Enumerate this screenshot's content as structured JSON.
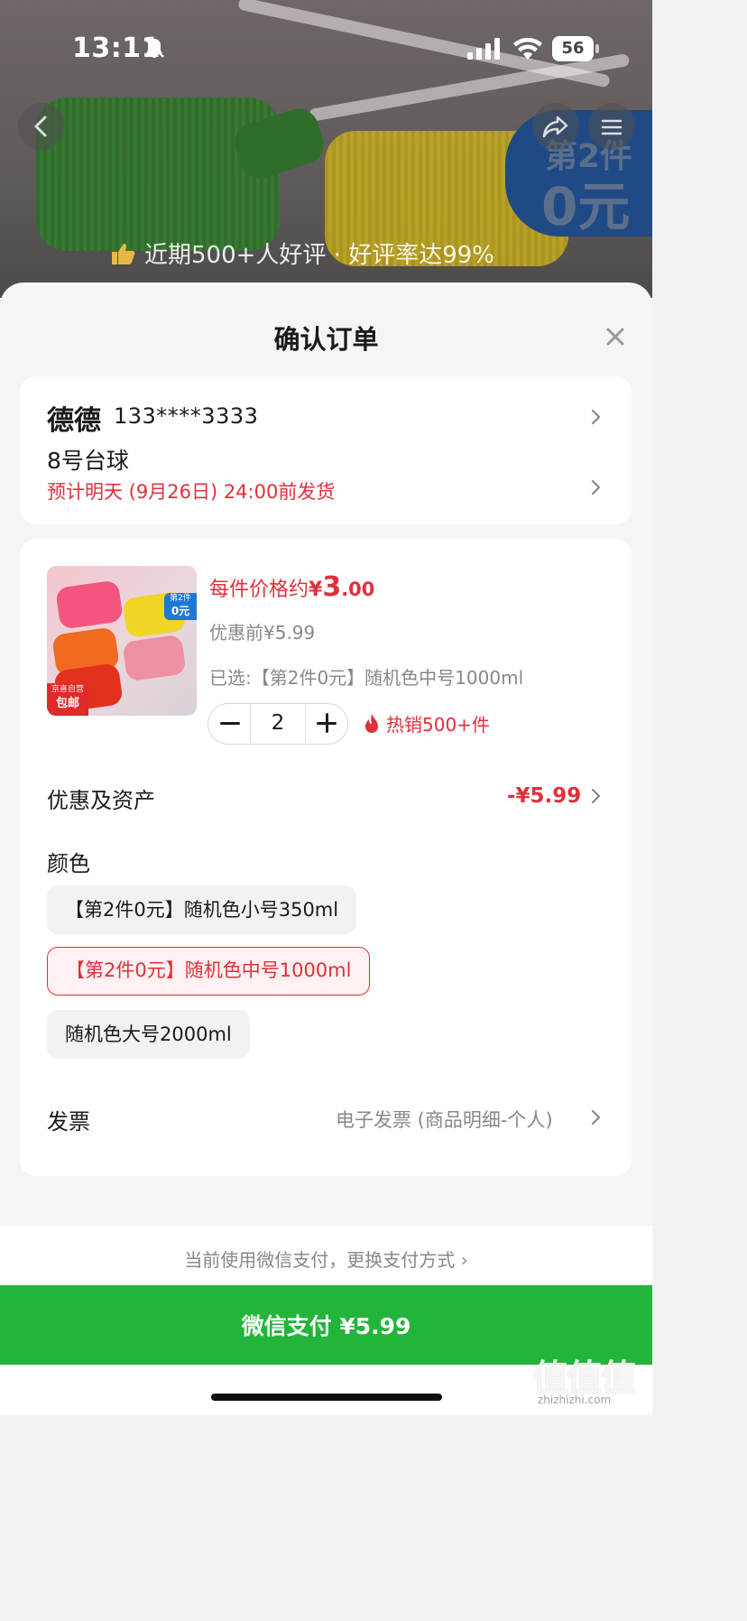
{
  "status_bar": {
    "time": "13:11",
    "battery": "56"
  },
  "banner": {
    "promo_line1": "第2件",
    "promo_line2": "0元",
    "review_text": "近期500+人好评 · 好评率达99%"
  },
  "sheet": {
    "title": "确认订单"
  },
  "address": {
    "name": "德德",
    "phone": "133****3333",
    "address_line": "8号台球",
    "delivery_estimate": "预计明天 (9月26日) 24:00前发货"
  },
  "product": {
    "image_badge_line1": "第2件",
    "image_badge_line2": "0元",
    "image_tag_line1": "京喜自营",
    "image_tag_line2": "包邮",
    "unit_price_prefix": "每件价格约",
    "unit_price_currency": "¥",
    "unit_price_int": "3",
    "unit_price_dec": ".00",
    "original_price": "优惠前¥5.99",
    "selected_spec": "已选:【第2件0元】随机色中号1000ml",
    "quantity": "2",
    "hot_sale": "热销500+件"
  },
  "discount": {
    "label": "优惠及资产",
    "value": "-¥5.99"
  },
  "color": {
    "label": "颜色",
    "options": [
      {
        "label": "【第2件0元】随机色小号350ml",
        "selected": false
      },
      {
        "label": "【第2件0元】随机色中号1000ml",
        "selected": true
      },
      {
        "label": "随机色大号2000ml",
        "selected": false
      }
    ]
  },
  "invoice": {
    "label": "发票",
    "value": "电子发票 (商品明细-个人)"
  },
  "payment": {
    "method_hint": "当前使用微信支付，更换支付方式 ›",
    "button_label": "微信支付 ¥5.99"
  },
  "watermark": {
    "main": "值值值",
    "sub": "zhizhizhi.com"
  },
  "colors": {
    "accent_red": "#e0303c",
    "pay_green": "#22b53a",
    "badge_blue": "#1f4a86"
  }
}
